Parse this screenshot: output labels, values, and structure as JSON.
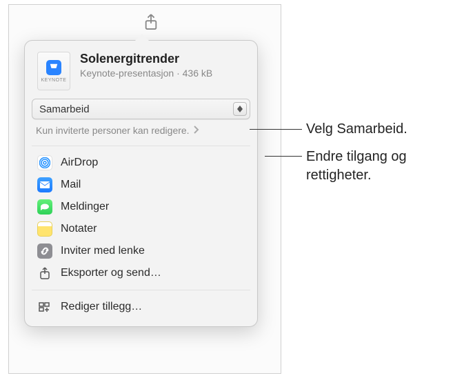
{
  "file": {
    "icon_label": "KEYNOTE",
    "title": "Solenergitrender",
    "subtitle": "Keynote-presentasjon · 436 kB"
  },
  "dropdown": {
    "selected": "Samarbeid"
  },
  "permissions": {
    "text": "Kun inviterte personer kan redigere."
  },
  "share_options": {
    "airdrop": "AirDrop",
    "mail": "Mail",
    "messages": "Meldinger",
    "notes": "Notater",
    "invite_link": "Inviter med lenke",
    "export": "Eksporter og send…"
  },
  "edit_extensions": "Rediger tillegg…",
  "callouts": {
    "c1": "Velg Samarbeid.",
    "c2": "Endre tilgang og rettigheter."
  }
}
